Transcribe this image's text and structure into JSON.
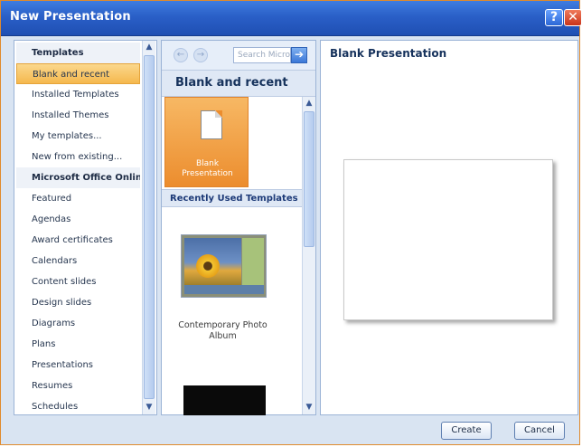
{
  "window": {
    "title": "New Presentation",
    "help_label": "?",
    "close_label": "✕"
  },
  "left_pane": {
    "items": [
      {
        "label": "Templates",
        "type": "section"
      },
      {
        "label": "Blank and recent",
        "type": "selected"
      },
      {
        "label": "Installed Templates",
        "type": "item"
      },
      {
        "label": "Installed Themes",
        "type": "item"
      },
      {
        "label": "My templates...",
        "type": "item"
      },
      {
        "label": "New from existing...",
        "type": "item"
      },
      {
        "label": "Microsoft Office Online",
        "type": "section"
      },
      {
        "label": "Featured",
        "type": "item"
      },
      {
        "label": "Agendas",
        "type": "item"
      },
      {
        "label": "Award certificates",
        "type": "item"
      },
      {
        "label": "Calendars",
        "type": "item"
      },
      {
        "label": "Content slides",
        "type": "item"
      },
      {
        "label": "Design slides",
        "type": "item"
      },
      {
        "label": "Diagrams",
        "type": "item"
      },
      {
        "label": "Plans",
        "type": "item"
      },
      {
        "label": "Presentations",
        "type": "item"
      },
      {
        "label": "Resumes",
        "type": "item"
      },
      {
        "label": "Schedules",
        "type": "item"
      }
    ]
  },
  "middle_pane": {
    "search_placeholder": "Search Micro",
    "back_icon": "←",
    "forward_icon": "→",
    "go_icon": "➔",
    "header": "Blank and recent",
    "blank_tile_label_1": "Blank",
    "blank_tile_label_2": "Presentation",
    "recent_header": "Recently Used Templates",
    "photo_label": "Contemporary Photo Album"
  },
  "right_pane": {
    "title": "Blank Presentation"
  },
  "buttons": {
    "create": "Create",
    "cancel": "Cancel"
  },
  "colors": {
    "accent": "#2a5fc7",
    "selected": "#f5b84d",
    "frame": "#e08a2c"
  }
}
